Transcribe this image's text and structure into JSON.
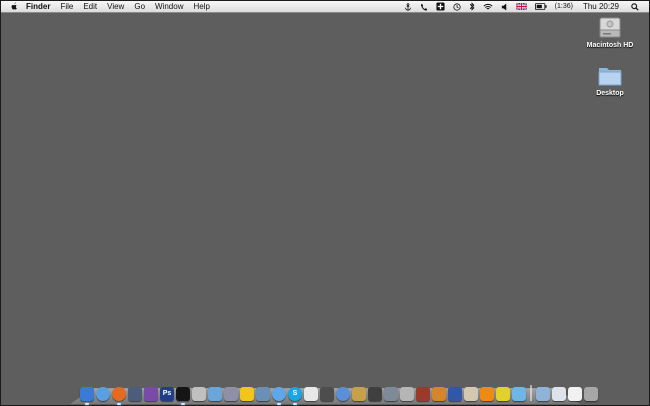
{
  "menubar": {
    "app_name": "Finder",
    "menus": [
      "File",
      "Edit",
      "View",
      "Go",
      "Window",
      "Help"
    ],
    "battery_time": "(1:36)",
    "clock": "Thu 20:29"
  },
  "desktop": {
    "icons": [
      {
        "label": "Macintosh HD",
        "icon": "hard-drive-icon"
      },
      {
        "label": "Desktop",
        "icon": "folder-icon"
      }
    ]
  },
  "dock": {
    "apps": [
      {
        "name": "finder",
        "color": "#3b7ad6"
      },
      {
        "name": "safari",
        "color": "#5aa0e0"
      },
      {
        "name": "firefox",
        "color": "#e46a22"
      },
      {
        "name": "generic-app",
        "color": "#4b5d7a"
      },
      {
        "name": "generic-app",
        "color": "#7a4aa8"
      },
      {
        "name": "photoshop",
        "color": "#1f3f8a",
        "glyph": "Ps"
      },
      {
        "name": "terminal",
        "color": "#151515"
      },
      {
        "name": "generic-app",
        "color": "#c0c0c0"
      },
      {
        "name": "generic-app",
        "color": "#6aa7d8"
      },
      {
        "name": "generic-app",
        "color": "#8f8fa6"
      },
      {
        "name": "adium",
        "color": "#f2c51d"
      },
      {
        "name": "generic-app",
        "color": "#6b8fb5"
      },
      {
        "name": "messages",
        "color": "#5fa7e8"
      },
      {
        "name": "skype",
        "color": "#1aa6e2",
        "glyph": "S"
      },
      {
        "name": "calendar",
        "color": "#e8e8e8"
      },
      {
        "name": "generic-app",
        "color": "#4d4d4d"
      },
      {
        "name": "itunes",
        "color": "#5b8fd8"
      },
      {
        "name": "generic-app",
        "color": "#c7a04a"
      },
      {
        "name": "generic-app",
        "color": "#3f3f3f"
      },
      {
        "name": "generic-app",
        "color": "#7f8a99"
      },
      {
        "name": "generic-app",
        "color": "#b5b5b5"
      },
      {
        "name": "generic-app",
        "color": "#9a3a2a"
      },
      {
        "name": "generic-app",
        "color": "#d5862a"
      },
      {
        "name": "generic-app",
        "color": "#3257a8"
      },
      {
        "name": "generic-app",
        "color": "#d4c8b0"
      },
      {
        "name": "vlc",
        "color": "#ef8a14"
      },
      {
        "name": "generic-app",
        "color": "#e0d22a"
      },
      {
        "name": "generic-app",
        "color": "#6fb6e6"
      }
    ],
    "stacks": [
      {
        "name": "applications-folder",
        "color": "#8fb3d6"
      },
      {
        "name": "documents-stack",
        "color": "#dde3ea"
      },
      {
        "name": "downloads-stack",
        "color": "#f1f1f1"
      },
      {
        "name": "trash",
        "color": "#a7a7a7"
      }
    ]
  }
}
